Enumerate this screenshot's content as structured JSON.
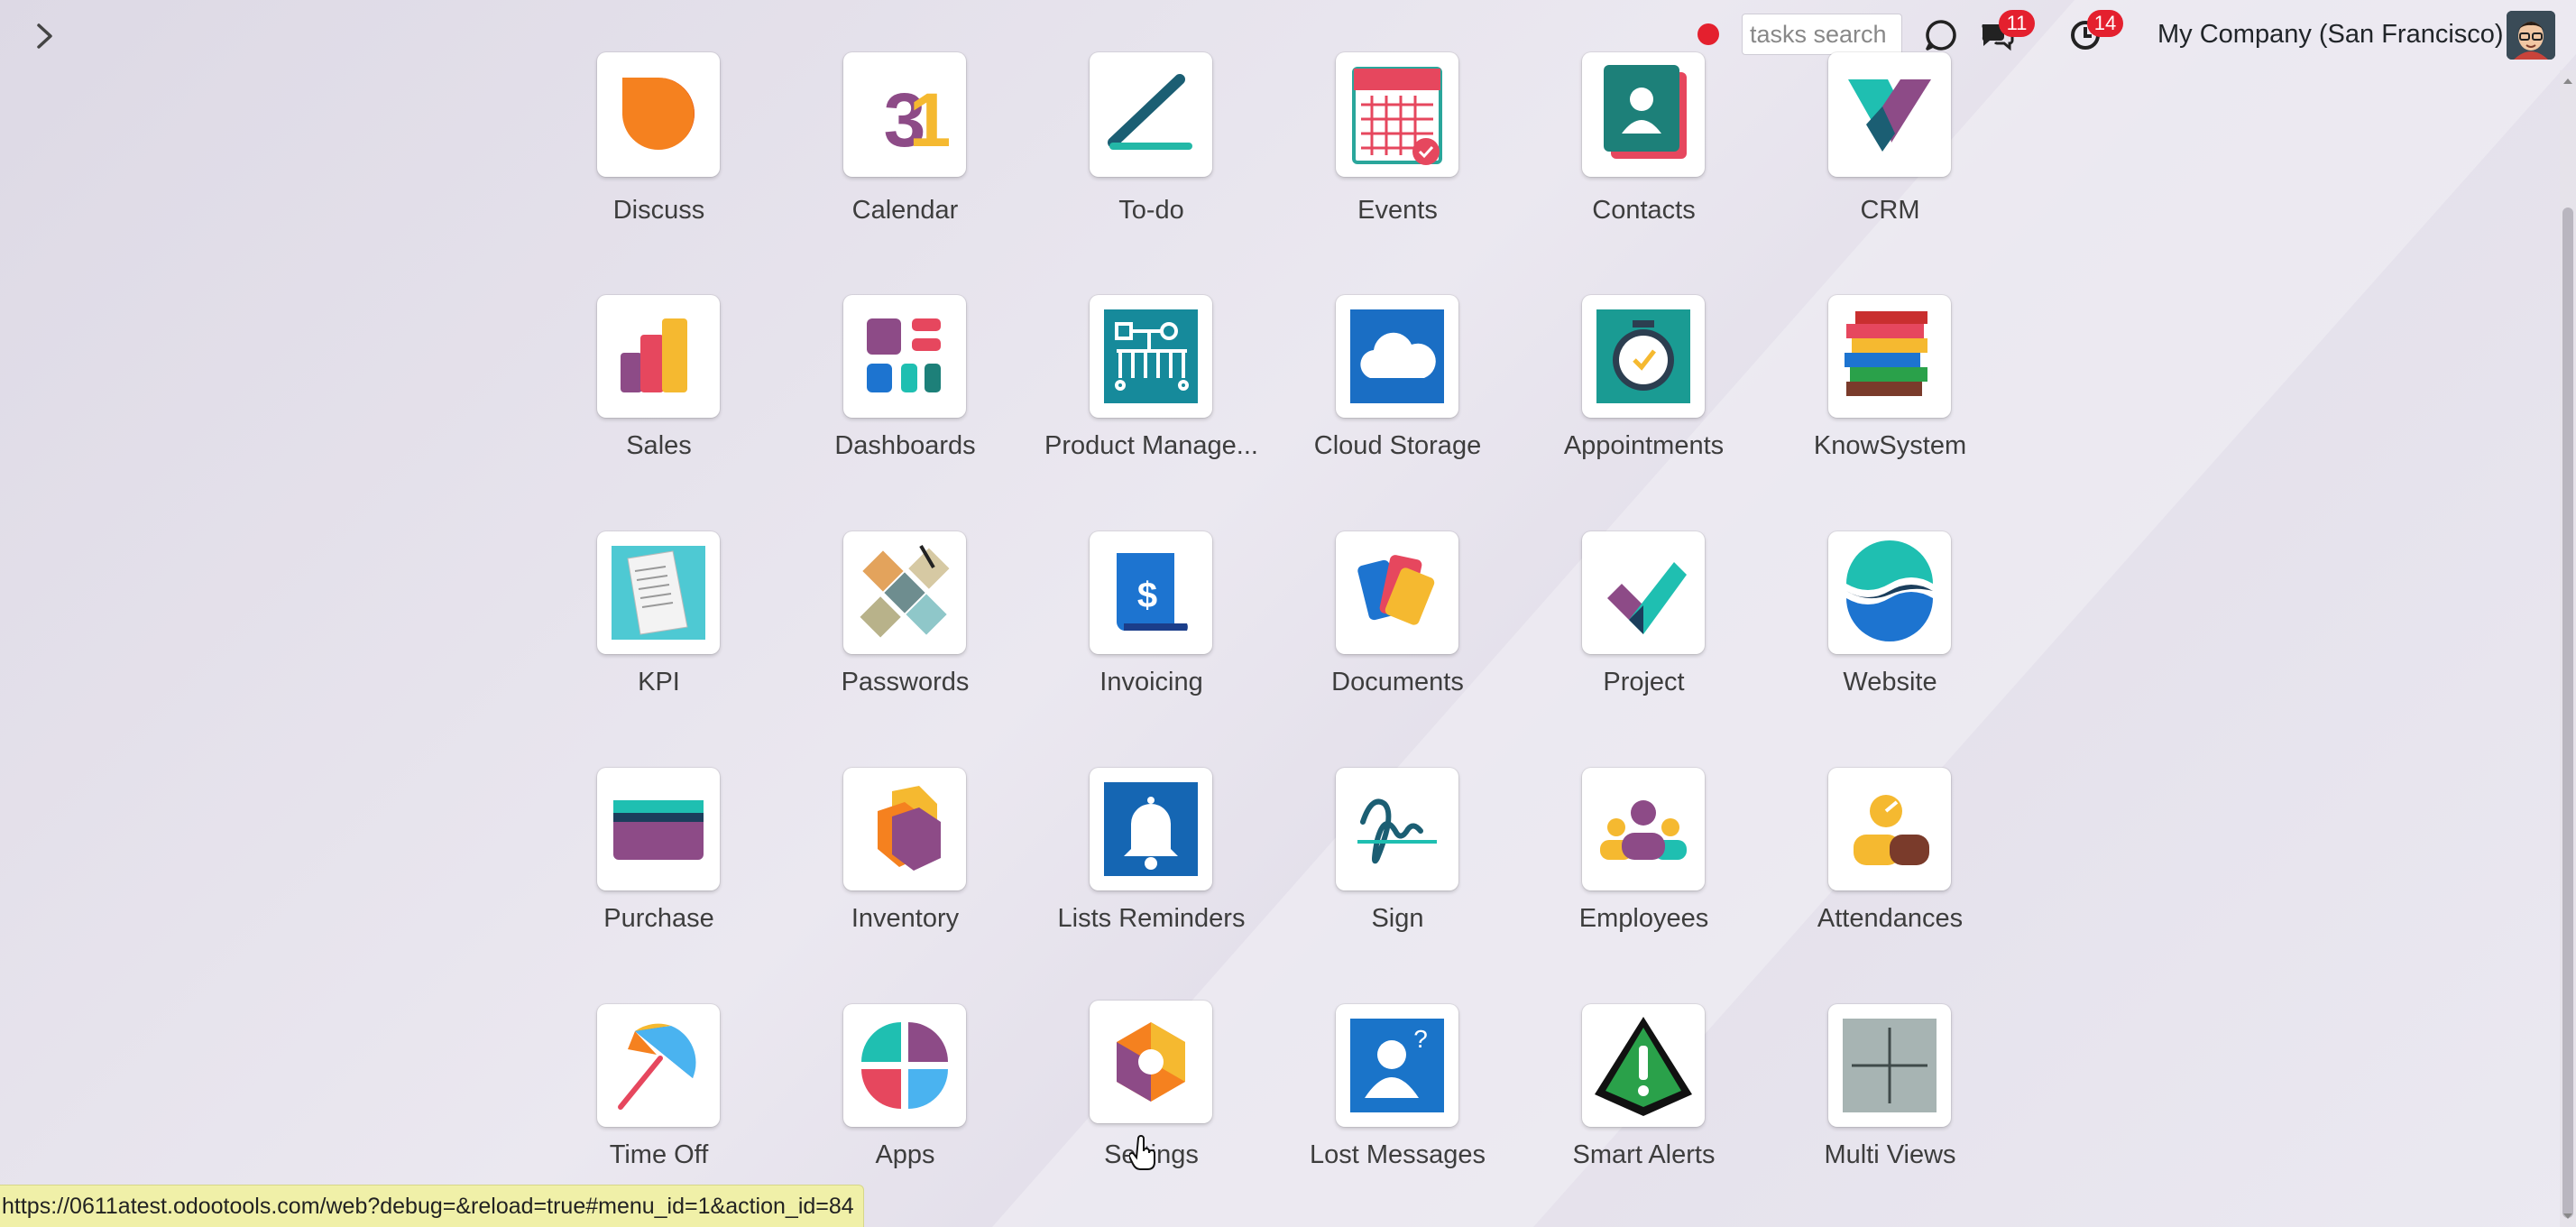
{
  "topbar": {
    "search_placeholder": "tasks search",
    "messages_badge": "11",
    "activities_badge": "14",
    "company_name": "My Company (San Francisco)",
    "badge_color": "#e4202e"
  },
  "apps": [
    {
      "label": "Discuss",
      "icon": "discuss-icon"
    },
    {
      "label": "Calendar",
      "icon": "calendar-icon"
    },
    {
      "label": "To-do",
      "icon": "todo-icon"
    },
    {
      "label": "Events",
      "icon": "events-icon"
    },
    {
      "label": "Contacts",
      "icon": "contacts-icon"
    },
    {
      "label": "CRM",
      "icon": "crm-icon"
    },
    {
      "label": "Sales",
      "icon": "sales-icon"
    },
    {
      "label": "Dashboards",
      "icon": "dashboards-icon"
    },
    {
      "label": "Product Manage...",
      "icon": "product-management-icon"
    },
    {
      "label": "Cloud Storage",
      "icon": "cloud-storage-icon"
    },
    {
      "label": "Appointments",
      "icon": "appointments-icon"
    },
    {
      "label": "KnowSystem",
      "icon": "knowsystem-icon"
    },
    {
      "label": "KPI",
      "icon": "kpi-icon"
    },
    {
      "label": "Passwords",
      "icon": "passwords-icon"
    },
    {
      "label": "Invoicing",
      "icon": "invoicing-icon"
    },
    {
      "label": "Documents",
      "icon": "documents-icon"
    },
    {
      "label": "Project",
      "icon": "project-icon"
    },
    {
      "label": "Website",
      "icon": "website-icon"
    },
    {
      "label": "Purchase",
      "icon": "purchase-icon"
    },
    {
      "label": "Inventory",
      "icon": "inventory-icon"
    },
    {
      "label": "Lists Reminders",
      "icon": "lists-reminders-icon"
    },
    {
      "label": "Sign",
      "icon": "sign-icon"
    },
    {
      "label": "Employees",
      "icon": "employees-icon"
    },
    {
      "label": "Attendances",
      "icon": "attendances-icon"
    },
    {
      "label": "Time Off",
      "icon": "time-off-icon"
    },
    {
      "label": "Apps",
      "icon": "apps-icon"
    },
    {
      "label": "Settings",
      "icon": "settings-icon"
    },
    {
      "label": "Lost Messages",
      "icon": "lost-messages-icon"
    },
    {
      "label": "Smart Alerts",
      "icon": "smart-alerts-icon"
    },
    {
      "label": "Multi Views",
      "icon": "multi-views-icon"
    }
  ],
  "status_url": "https://0611atest.odootools.com/web?debug=&reload=true#menu_id=1&action_id=84"
}
